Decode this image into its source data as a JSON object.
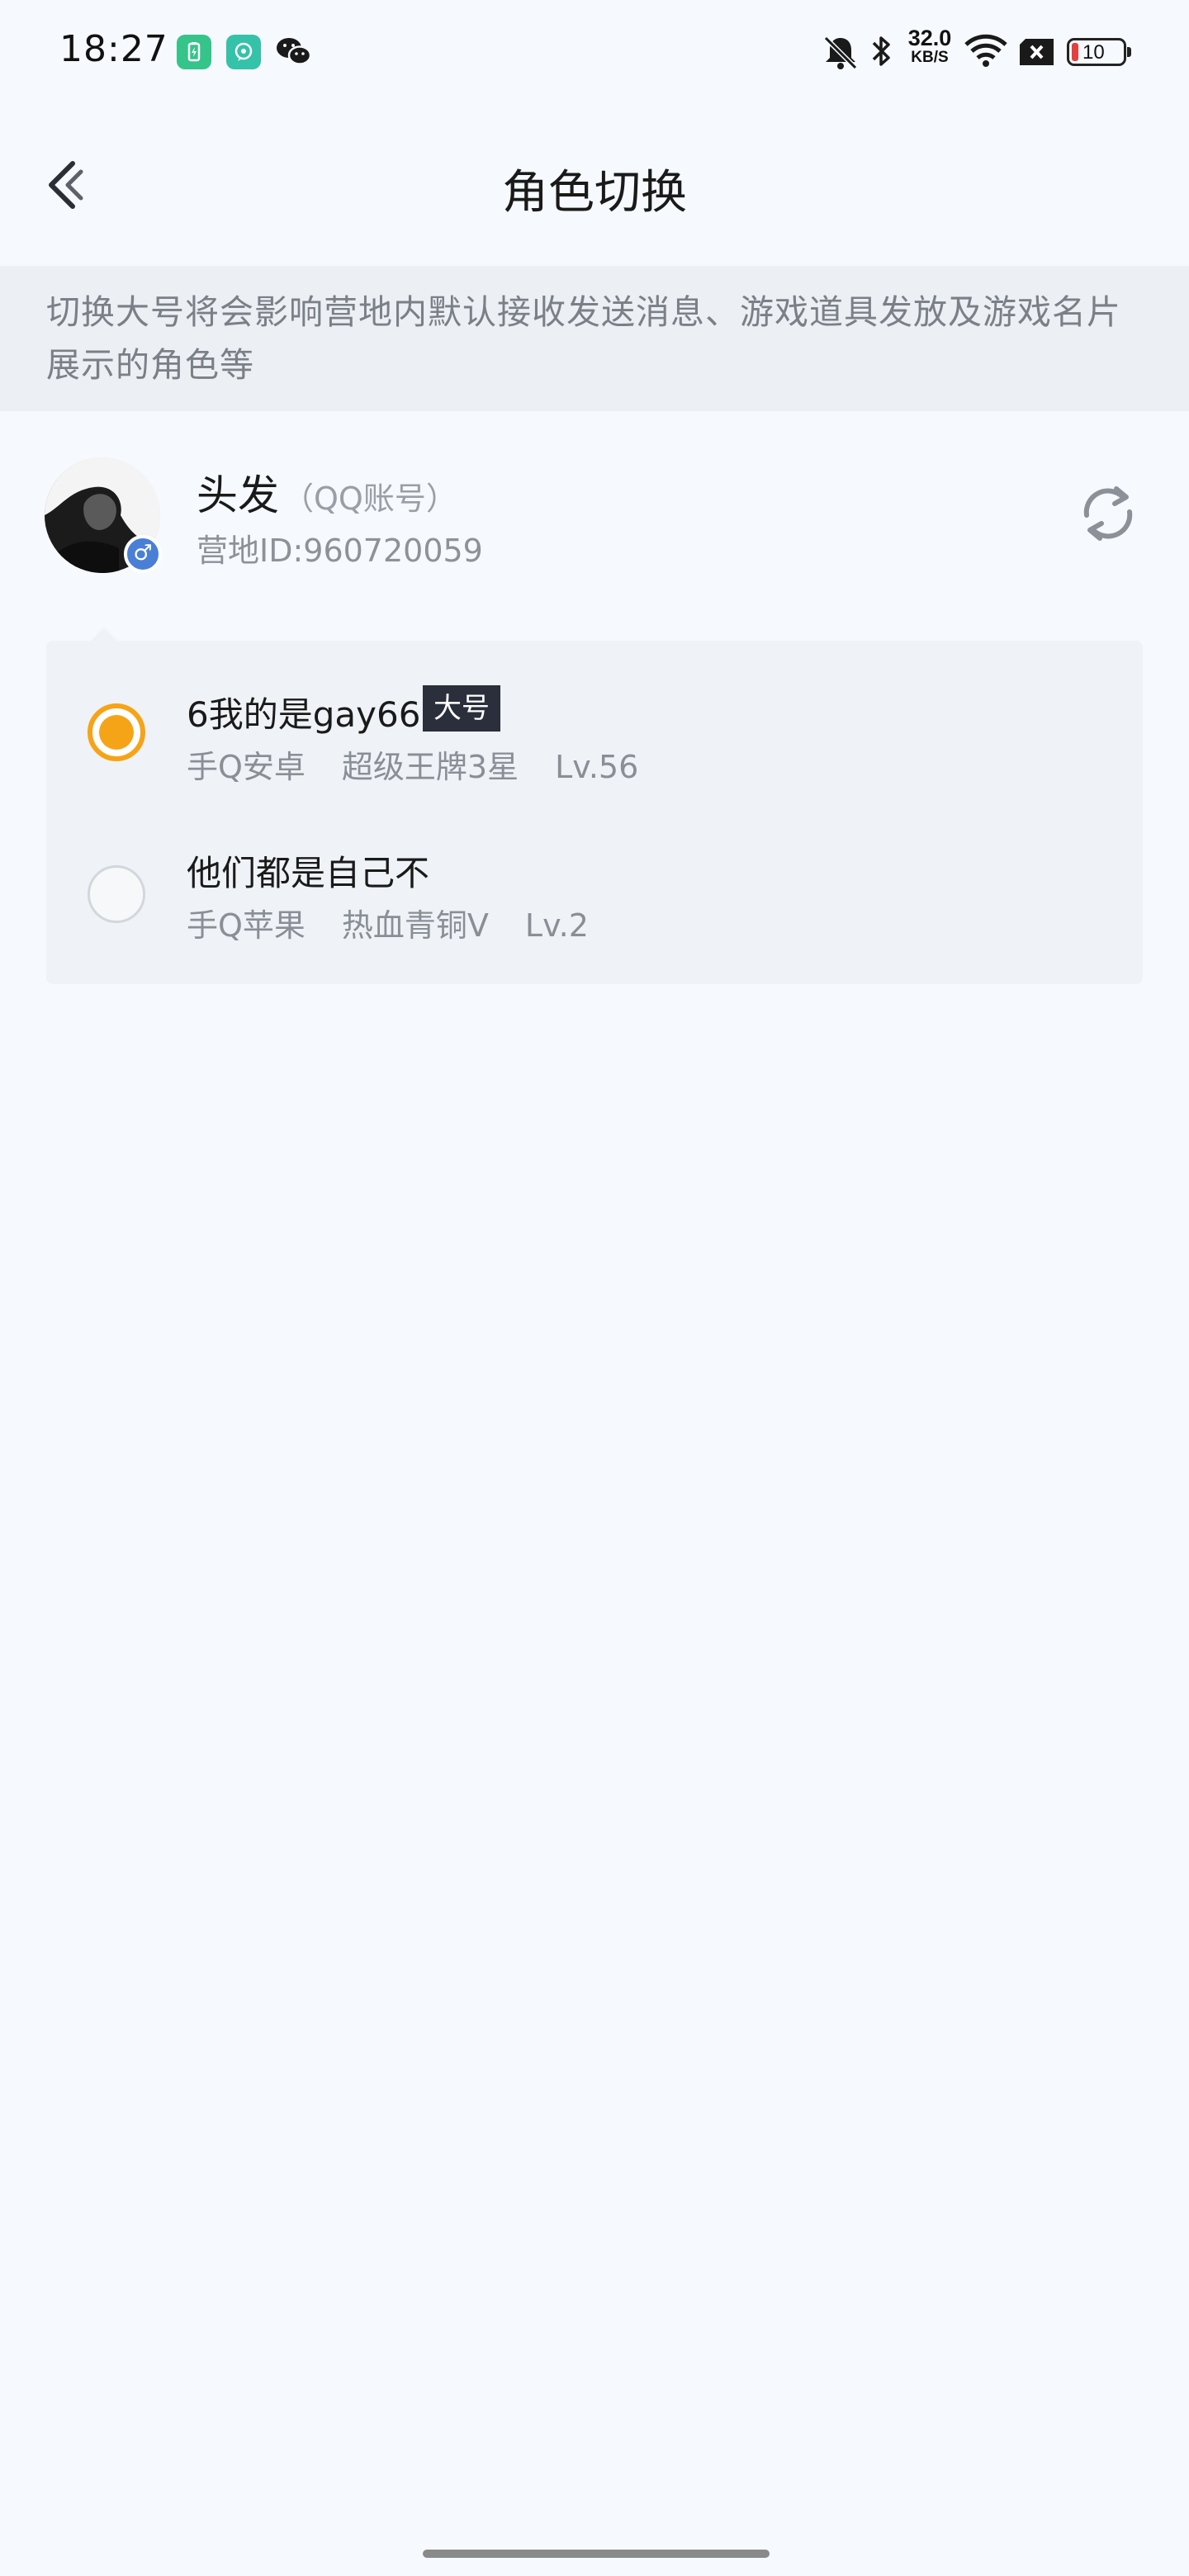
{
  "status_bar": {
    "time": "18:27",
    "left_icons": [
      "battery-saver-icon",
      "chat-app-icon",
      "wechat-icon"
    ],
    "net_speed": "32.0",
    "net_speed_unit": "KB/S",
    "battery_level": "10",
    "battery_color": "#e34040"
  },
  "header": {
    "title": "角色切换"
  },
  "notice": {
    "text": "切换大号将会影响营地内默认接收发送消息、游戏道具发放及游戏名片展示的角色等"
  },
  "account": {
    "name": "头发",
    "type": "（QQ账号）",
    "camp_id": "营地ID:960720059",
    "gender_symbol": "♂",
    "gender_color": "#4a7fd6"
  },
  "roles": [
    {
      "name": "6我的是gay666",
      "badge": "大号",
      "platform": "手Q安卓",
      "rank": "超级王牌3星",
      "level": "Lv.56",
      "selected": true
    },
    {
      "name": "他们都是自己不",
      "badge": "",
      "platform": "手Q苹果",
      "rank": "热血青铜Ⅴ",
      "level": "Lv.2",
      "selected": false
    }
  ],
  "colors": {
    "accent": "#f6a417",
    "background": "#f6f9fd",
    "banner": "#eceff3",
    "card": "#eff2f6"
  }
}
